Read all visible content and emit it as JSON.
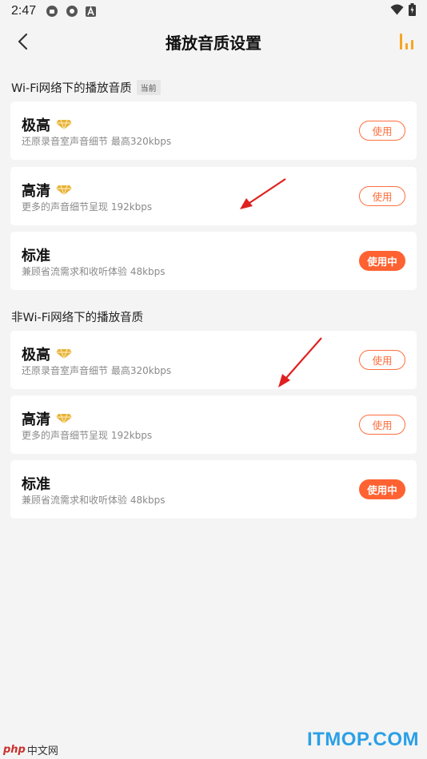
{
  "statusbar": {
    "time": "2:47"
  },
  "header": {
    "title": "播放音质设置",
    "back_icon": "back-arrow-icon",
    "eq_icon": "equalizer-icon"
  },
  "wifi_section": {
    "label": "Wi-Fi网络下的播放音质",
    "badge": "当前",
    "items": [
      {
        "name": "极高",
        "desc": "还原录音室声音细节 最高320kbps",
        "button": "使用",
        "active": false,
        "vip": true
      },
      {
        "name": "高清",
        "desc": "更多的声音细节呈现 192kbps",
        "button": "使用",
        "active": false,
        "vip": true
      },
      {
        "name": "标准",
        "desc": "兼顾省流需求和收听体验 48kbps",
        "button": "使用中",
        "active": true,
        "vip": false
      }
    ]
  },
  "nonwifi_section": {
    "label": "非Wi-Fi网络下的播放音质",
    "items": [
      {
        "name": "极高",
        "desc": "还原录音室声音细节 最高320kbps",
        "button": "使用",
        "active": false,
        "vip": true
      },
      {
        "name": "高清",
        "desc": "更多的声音细节呈现 192kbps",
        "button": "使用",
        "active": false,
        "vip": true
      },
      {
        "name": "标准",
        "desc": "兼顾省流需求和收听体验 48kbps",
        "button": "使用中",
        "active": true,
        "vip": false
      }
    ]
  },
  "watermarks": {
    "left_logo": "php",
    "left_text": "中文网",
    "right_text": "ITMOP.COM"
  },
  "colors": {
    "accent": "#ff6232",
    "accent_outline": "#ff6f3d",
    "eq": "#f5a623",
    "gem": "#e8b23c",
    "arrow": "#e02020"
  }
}
